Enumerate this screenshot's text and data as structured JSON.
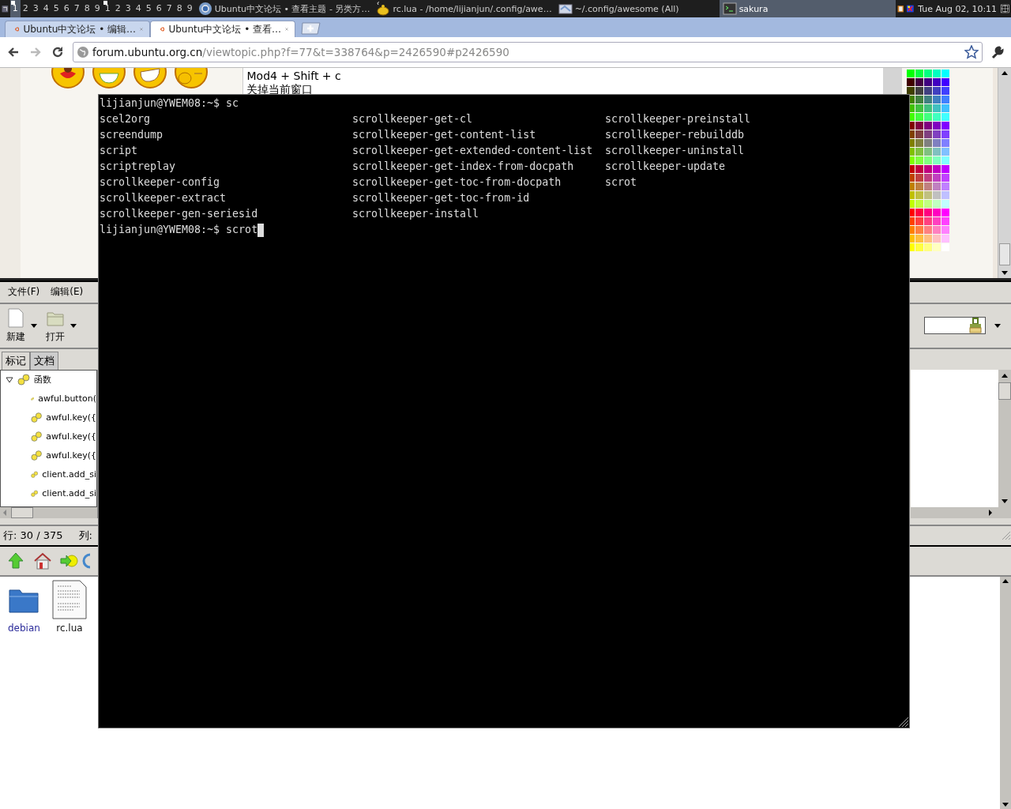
{
  "panel": {
    "tag_groups": [
      {
        "tags": [
          {
            "label": "1",
            "selected": true,
            "occupied": true
          },
          {
            "label": "2",
            "selected": false,
            "occupied": false
          },
          {
            "label": "3",
            "selected": false,
            "occupied": false
          },
          {
            "label": "4",
            "selected": false,
            "occupied": false
          },
          {
            "label": "5",
            "selected": false,
            "occupied": false
          },
          {
            "label": "6",
            "selected": false,
            "occupied": false
          },
          {
            "label": "7",
            "selected": false,
            "occupied": false
          },
          {
            "label": "8",
            "selected": false,
            "occupied": false
          },
          {
            "label": "9",
            "selected": false,
            "occupied": false
          }
        ]
      },
      {
        "tags": [
          {
            "label": "1",
            "selected": false,
            "occupied": true
          },
          {
            "label": "2",
            "selected": false,
            "occupied": false
          },
          {
            "label": "3",
            "selected": false,
            "occupied": false
          },
          {
            "label": "4",
            "selected": false,
            "occupied": false
          },
          {
            "label": "5",
            "selected": false,
            "occupied": false
          },
          {
            "label": "6",
            "selected": false,
            "occupied": false
          },
          {
            "label": "7",
            "selected": false,
            "occupied": false
          },
          {
            "label": "8",
            "selected": false,
            "occupied": false
          },
          {
            "label": "9",
            "selected": false,
            "occupied": false
          }
        ]
      }
    ],
    "tasks": [
      {
        "label": "Ubuntu中文论坛 • 查看主题 - 另类方…",
        "selected": false
      },
      {
        "label": "rc.lua - /home/lijianjun/.config/awe…",
        "selected": false
      },
      {
        "label": "~/.config/awesome (All)",
        "selected": false
      },
      {
        "label": "sakura",
        "selected": true
      }
    ],
    "clock": "Tue Aug 02, 10:11"
  },
  "browser": {
    "tabs": [
      {
        "title": "Ubuntu中文论坛 • 编辑…",
        "selected": false
      },
      {
        "title": "Ubuntu中文论坛 • 查看…",
        "selected": true
      }
    ],
    "nav": [
      {
        "kind": "back",
        "disabled": false
      },
      {
        "kind": "forward",
        "disabled": true
      },
      {
        "kind": "reload",
        "disabled": false
      }
    ],
    "url": {
      "host": "forum.ubuntu.org.cn",
      "path": "/viewtopic.php?f=77&t=338764&p=2426590#p2426590"
    },
    "post_lines": [
      "Mod4 + Shift + c",
      "关掉当前窗口"
    ],
    "palette": [
      {
        "swatches": [
          {
            "color": "#00ff00"
          },
          {
            "color": "#00ff40"
          },
          {
            "color": "#00ff80"
          },
          {
            "color": "#00ffc0"
          },
          {
            "color": "#00ffff"
          }
        ]
      },
      {
        "swatches": [
          {
            "color": "#400000"
          },
          {
            "color": "#400040"
          },
          {
            "color": "#400080"
          },
          {
            "color": "#4000c0"
          },
          {
            "color": "#4000ff"
          }
        ]
      },
      {
        "swatches": [
          {
            "color": "#404000"
          },
          {
            "color": "#404040"
          },
          {
            "color": "#404080"
          },
          {
            "color": "#4040c0"
          },
          {
            "color": "#4040ff"
          }
        ]
      },
      {
        "swatches": [
          {
            "color": "#408000"
          },
          {
            "color": "#408040"
          },
          {
            "color": "#408080"
          },
          {
            "color": "#4080c0"
          },
          {
            "color": "#4080ff"
          }
        ]
      },
      {
        "swatches": [
          {
            "color": "#40c000"
          },
          {
            "color": "#40c040"
          },
          {
            "color": "#40c080"
          },
          {
            "color": "#40c0c0"
          },
          {
            "color": "#40c0ff"
          }
        ]
      },
      {
        "swatches": [
          {
            "color": "#40ff00"
          },
          {
            "color": "#40ff40"
          },
          {
            "color": "#40ff80"
          },
          {
            "color": "#40ffc0"
          },
          {
            "color": "#40ffff"
          }
        ]
      },
      {
        "swatches": [
          {
            "color": "#800000"
          },
          {
            "color": "#800040"
          },
          {
            "color": "#800080"
          },
          {
            "color": "#8000c0"
          },
          {
            "color": "#8000ff"
          }
        ]
      },
      {
        "swatches": [
          {
            "color": "#804000"
          },
          {
            "color": "#804040"
          },
          {
            "color": "#804080"
          },
          {
            "color": "#8040c0"
          },
          {
            "color": "#8040ff"
          }
        ]
      },
      {
        "swatches": [
          {
            "color": "#808000"
          },
          {
            "color": "#808040"
          },
          {
            "color": "#808080"
          },
          {
            "color": "#8080c0"
          },
          {
            "color": "#8080ff"
          }
        ]
      },
      {
        "swatches": [
          {
            "color": "#80c000"
          },
          {
            "color": "#80c040"
          },
          {
            "color": "#80c080"
          },
          {
            "color": "#80c0c0"
          },
          {
            "color": "#80c0ff"
          }
        ]
      },
      {
        "swatches": [
          {
            "color": "#80ff00"
          },
          {
            "color": "#80ff40"
          },
          {
            "color": "#80ff80"
          },
          {
            "color": "#80ffc0"
          },
          {
            "color": "#80ffff"
          }
        ]
      },
      {
        "swatches": [
          {
            "color": "#c00000"
          },
          {
            "color": "#c00040"
          },
          {
            "color": "#c00080"
          },
          {
            "color": "#c000c0"
          },
          {
            "color": "#c000ff"
          }
        ]
      },
      {
        "swatches": [
          {
            "color": "#c04000"
          },
          {
            "color": "#c04040"
          },
          {
            "color": "#c04080"
          },
          {
            "color": "#c040c0"
          },
          {
            "color": "#c040ff"
          }
        ]
      },
      {
        "swatches": [
          {
            "color": "#c08000"
          },
          {
            "color": "#c08040"
          },
          {
            "color": "#c08080"
          },
          {
            "color": "#c080c0"
          },
          {
            "color": "#c080ff"
          }
        ]
      },
      {
        "swatches": [
          {
            "color": "#c0c000"
          },
          {
            "color": "#c0c040"
          },
          {
            "color": "#c0c080"
          },
          {
            "color": "#c0c0c0"
          },
          {
            "color": "#c0c0ff"
          }
        ]
      },
      {
        "swatches": [
          {
            "color": "#c0ff00"
          },
          {
            "color": "#c0ff40"
          },
          {
            "color": "#c0ff80"
          },
          {
            "color": "#c0ffc0"
          },
          {
            "color": "#c0ffff"
          }
        ]
      },
      {
        "swatches": [
          {
            "color": "#ff0000"
          },
          {
            "color": "#ff0040"
          },
          {
            "color": "#ff0080"
          },
          {
            "color": "#ff00c0"
          },
          {
            "color": "#ff00ff"
          }
        ]
      },
      {
        "swatches": [
          {
            "color": "#ff4000"
          },
          {
            "color": "#ff4040"
          },
          {
            "color": "#ff4080"
          },
          {
            "color": "#ff40c0"
          },
          {
            "color": "#ff40ff"
          }
        ]
      },
      {
        "swatches": [
          {
            "color": "#ff8000"
          },
          {
            "color": "#ff8040"
          },
          {
            "color": "#ff8080"
          },
          {
            "color": "#ff80c0"
          },
          {
            "color": "#ff80ff"
          }
        ]
      },
      {
        "swatches": [
          {
            "color": "#ffc000"
          },
          {
            "color": "#ffc040"
          },
          {
            "color": "#ffc080"
          },
          {
            "color": "#ffc0c0"
          },
          {
            "color": "#ffc0ff"
          }
        ]
      },
      {
        "swatches": [
          {
            "color": "#ffff00"
          },
          {
            "color": "#ffff40"
          },
          {
            "color": "#ffff80"
          },
          {
            "color": "#ffffc0"
          },
          {
            "color": "#ffffff"
          }
        ]
      }
    ]
  },
  "editor": {
    "menu": [
      "文件(F)",
      "编辑(E)"
    ],
    "toolbar": [
      {
        "label": "新建"
      },
      {
        "label": "打开"
      }
    ],
    "side_tabs": [
      {
        "label": "标记",
        "selected": true
      },
      {
        "label": "文档",
        "selected": false
      }
    ],
    "tree": [
      {
        "label": "函数",
        "expanded": true,
        "children": [
          {
            "label": "awful.button("
          },
          {
            "label": "awful.key({"
          },
          {
            "label": "awful.key({"
          },
          {
            "label": "awful.key({"
          },
          {
            "label": "client.add_si"
          },
          {
            "label": "client.add_si"
          }
        ]
      }
    ],
    "status": [
      "行: 30 / 375",
      "列:"
    ]
  },
  "files": {
    "items": [
      {
        "name": "debian",
        "kind": "folder",
        "link": true
      },
      {
        "name": "rc.lua",
        "kind": "file",
        "link": false
      }
    ]
  },
  "terminal": {
    "prompt_line": "lijianjun@YWEM08:~$ sc",
    "completions": [
      "scel2org",
      "screendump",
      "script",
      "scriptreplay",
      "scrollkeeper-config",
      "scrollkeeper-extract",
      "scrollkeeper-gen-seriesid",
      "scrollkeeper-get-cl",
      "scrollkeeper-get-content-list",
      "scrollkeeper-get-extended-content-list",
      "scrollkeeper-get-index-from-docpath",
      "scrollkeeper-get-toc-from-docpath",
      "scrollkeeper-get-toc-from-id",
      "scrollkeeper-install",
      "scrollkeeper-preinstall",
      "scrollkeeper-rebuilddb",
      "scrollkeeper-uninstall",
      "scrollkeeper-update",
      "scrot"
    ],
    "command_line": "lijianjun@YWEM08:~$ scrot"
  }
}
